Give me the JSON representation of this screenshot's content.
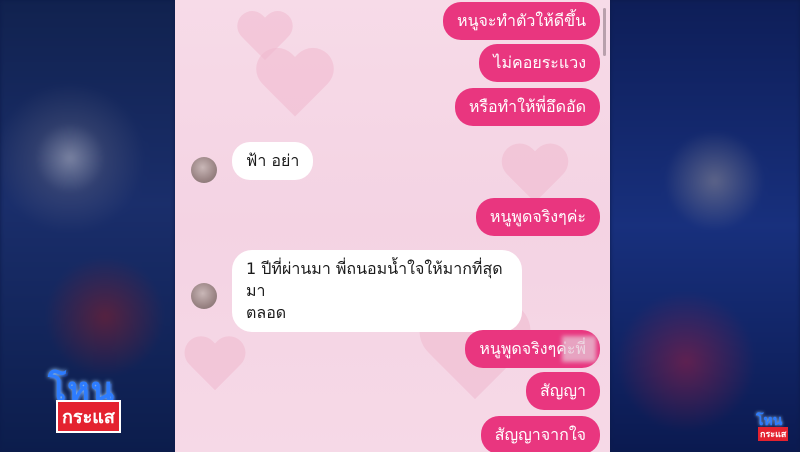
{
  "messages_out_top": [
    "หนูจะทำตัวให้ดีขึ้น",
    "ไม่คอยระแวง",
    "หรือทำให้พี่อึดอัด"
  ],
  "message_in_1": "ฟ้า อย่า",
  "message_out_2": "หนูพูดจริงๆค่ะ",
  "message_in_2": {
    "line1": "1 ปีที่ผ่านมา  พี่ถนอมน้ำใจให้มากที่สุดมา",
    "line2": "ตลอด"
  },
  "messages_out_bottom": [
    "หนูพูดจริงๆค่ะพี่",
    "สัญญา",
    "สัญญาจากใจ"
  ],
  "logo": {
    "top": "โหน",
    "bottom": "กระแส"
  },
  "colors": {
    "outgoing_bubble": "#e9367f",
    "incoming_bubble": "#ffffff",
    "chat_background": "#f6d9e7"
  }
}
